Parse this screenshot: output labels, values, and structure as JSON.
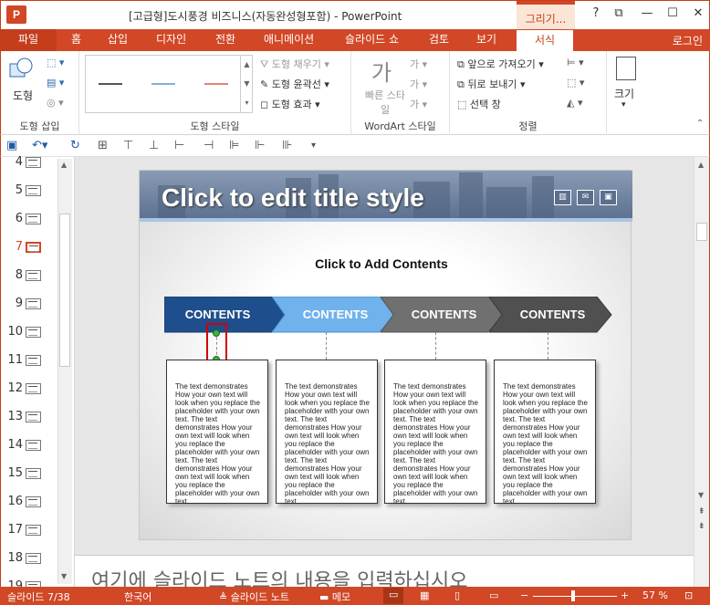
{
  "window": {
    "title": "[고급형]도시풍경 비즈니스(자동완성형포함) - PowerPoint",
    "app_icon": "P",
    "context_tab": "그리기...",
    "help": "?",
    "buttons": [
      "⧉",
      "—",
      "☐",
      "✕"
    ]
  },
  "tabs": [
    {
      "label": "파일",
      "x": 0
    },
    {
      "label": "홈"
    },
    {
      "label": "삽입"
    },
    {
      "label": "디자인"
    },
    {
      "label": "전환"
    },
    {
      "label": "애니메이션"
    },
    {
      "label": "슬라이드 쇼"
    },
    {
      "label": "검토"
    },
    {
      "label": "보기"
    },
    {
      "label": "서식"
    }
  ],
  "login": "로그인",
  "ribbon": {
    "insert_shapes": {
      "label": "도형 삽입",
      "shape_button": "도형"
    },
    "shape_styles": {
      "label": "도형 스타일",
      "fill": "도형 채우기",
      "outline": "도형 윤곽선",
      "effects": "도형 효과"
    },
    "wordart": {
      "label": "WordArt 스타일",
      "quick_styles": "빠른 스타일",
      "glyph": "가"
    },
    "arrange": {
      "label": "정렬",
      "bring_forward": "앞으로 가져오기",
      "send_backward": "뒤로 보내기",
      "selection_pane": "선택 창"
    },
    "size": {
      "label": "크기"
    }
  },
  "slides_panel": {
    "numbers": [
      "4",
      "5",
      "6",
      "7",
      "8",
      "9",
      "10",
      "11",
      "12",
      "13",
      "14",
      "15",
      "16",
      "17",
      "18",
      "19"
    ],
    "selected": "7"
  },
  "slide": {
    "title": "Click to edit title style",
    "add_contents": "Click to Add Contents",
    "arrows": [
      {
        "label": "CONTENTS",
        "color": "#1f4e8c"
      },
      {
        "label": "CONTENTS",
        "color": "#6fb2ec"
      },
      {
        "label": "CONTENTS",
        "color": "#707070"
      },
      {
        "label": "CONTENTS",
        "color": "#505050"
      }
    ],
    "card_text": "The text demonstrates How your own text will look when you replace the placeholder with your own text. The text demonstrates How your own text will look when you replace the placeholder with your own text. The text demonstrates How your own text will look when you replace the placeholder with your own text."
  },
  "notes": {
    "placeholder": "여기에 슬라이드 노트의 내용을 입력하십시오"
  },
  "status": {
    "slide": "슬라이드 7/38",
    "language": "한국어",
    "notes": "슬라이드 노트",
    "memo": "메모",
    "zoom": "57 %"
  }
}
